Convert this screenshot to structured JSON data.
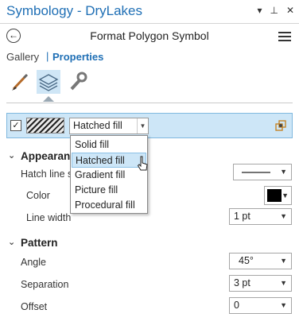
{
  "window": {
    "title": "Symbology - DryLakes"
  },
  "header": {
    "title": "Format Polygon Symbol"
  },
  "tabs": {
    "gallery": "Gallery",
    "separator": "|",
    "properties": "Properties"
  },
  "icons": [
    "paintbrush-icon",
    "layers-icon",
    "wrench-icon"
  ],
  "layer": {
    "fill_type": "Hatched fill",
    "enabled": true
  },
  "fill_menu": {
    "items": [
      "Solid fill",
      "Hatched fill",
      "Gradient fill",
      "Picture fill",
      "Procedural fill"
    ],
    "highlighted": "Hatched fill"
  },
  "appearance": {
    "title": "Appearance",
    "hatch_line_label": "Hatch line s",
    "color_label": "Color",
    "line_width_label": "Line width",
    "line_width_value": "1 pt"
  },
  "pattern": {
    "title": "Pattern",
    "angle_label": "Angle",
    "angle_value": "45°",
    "separation_label": "Separation",
    "separation_value": "3 pt",
    "offset_label": "Offset",
    "offset_value": "0"
  },
  "colors": {
    "accent": "#1f6fb5",
    "selection": "#cde6f7",
    "color_swatch": "#000000"
  }
}
